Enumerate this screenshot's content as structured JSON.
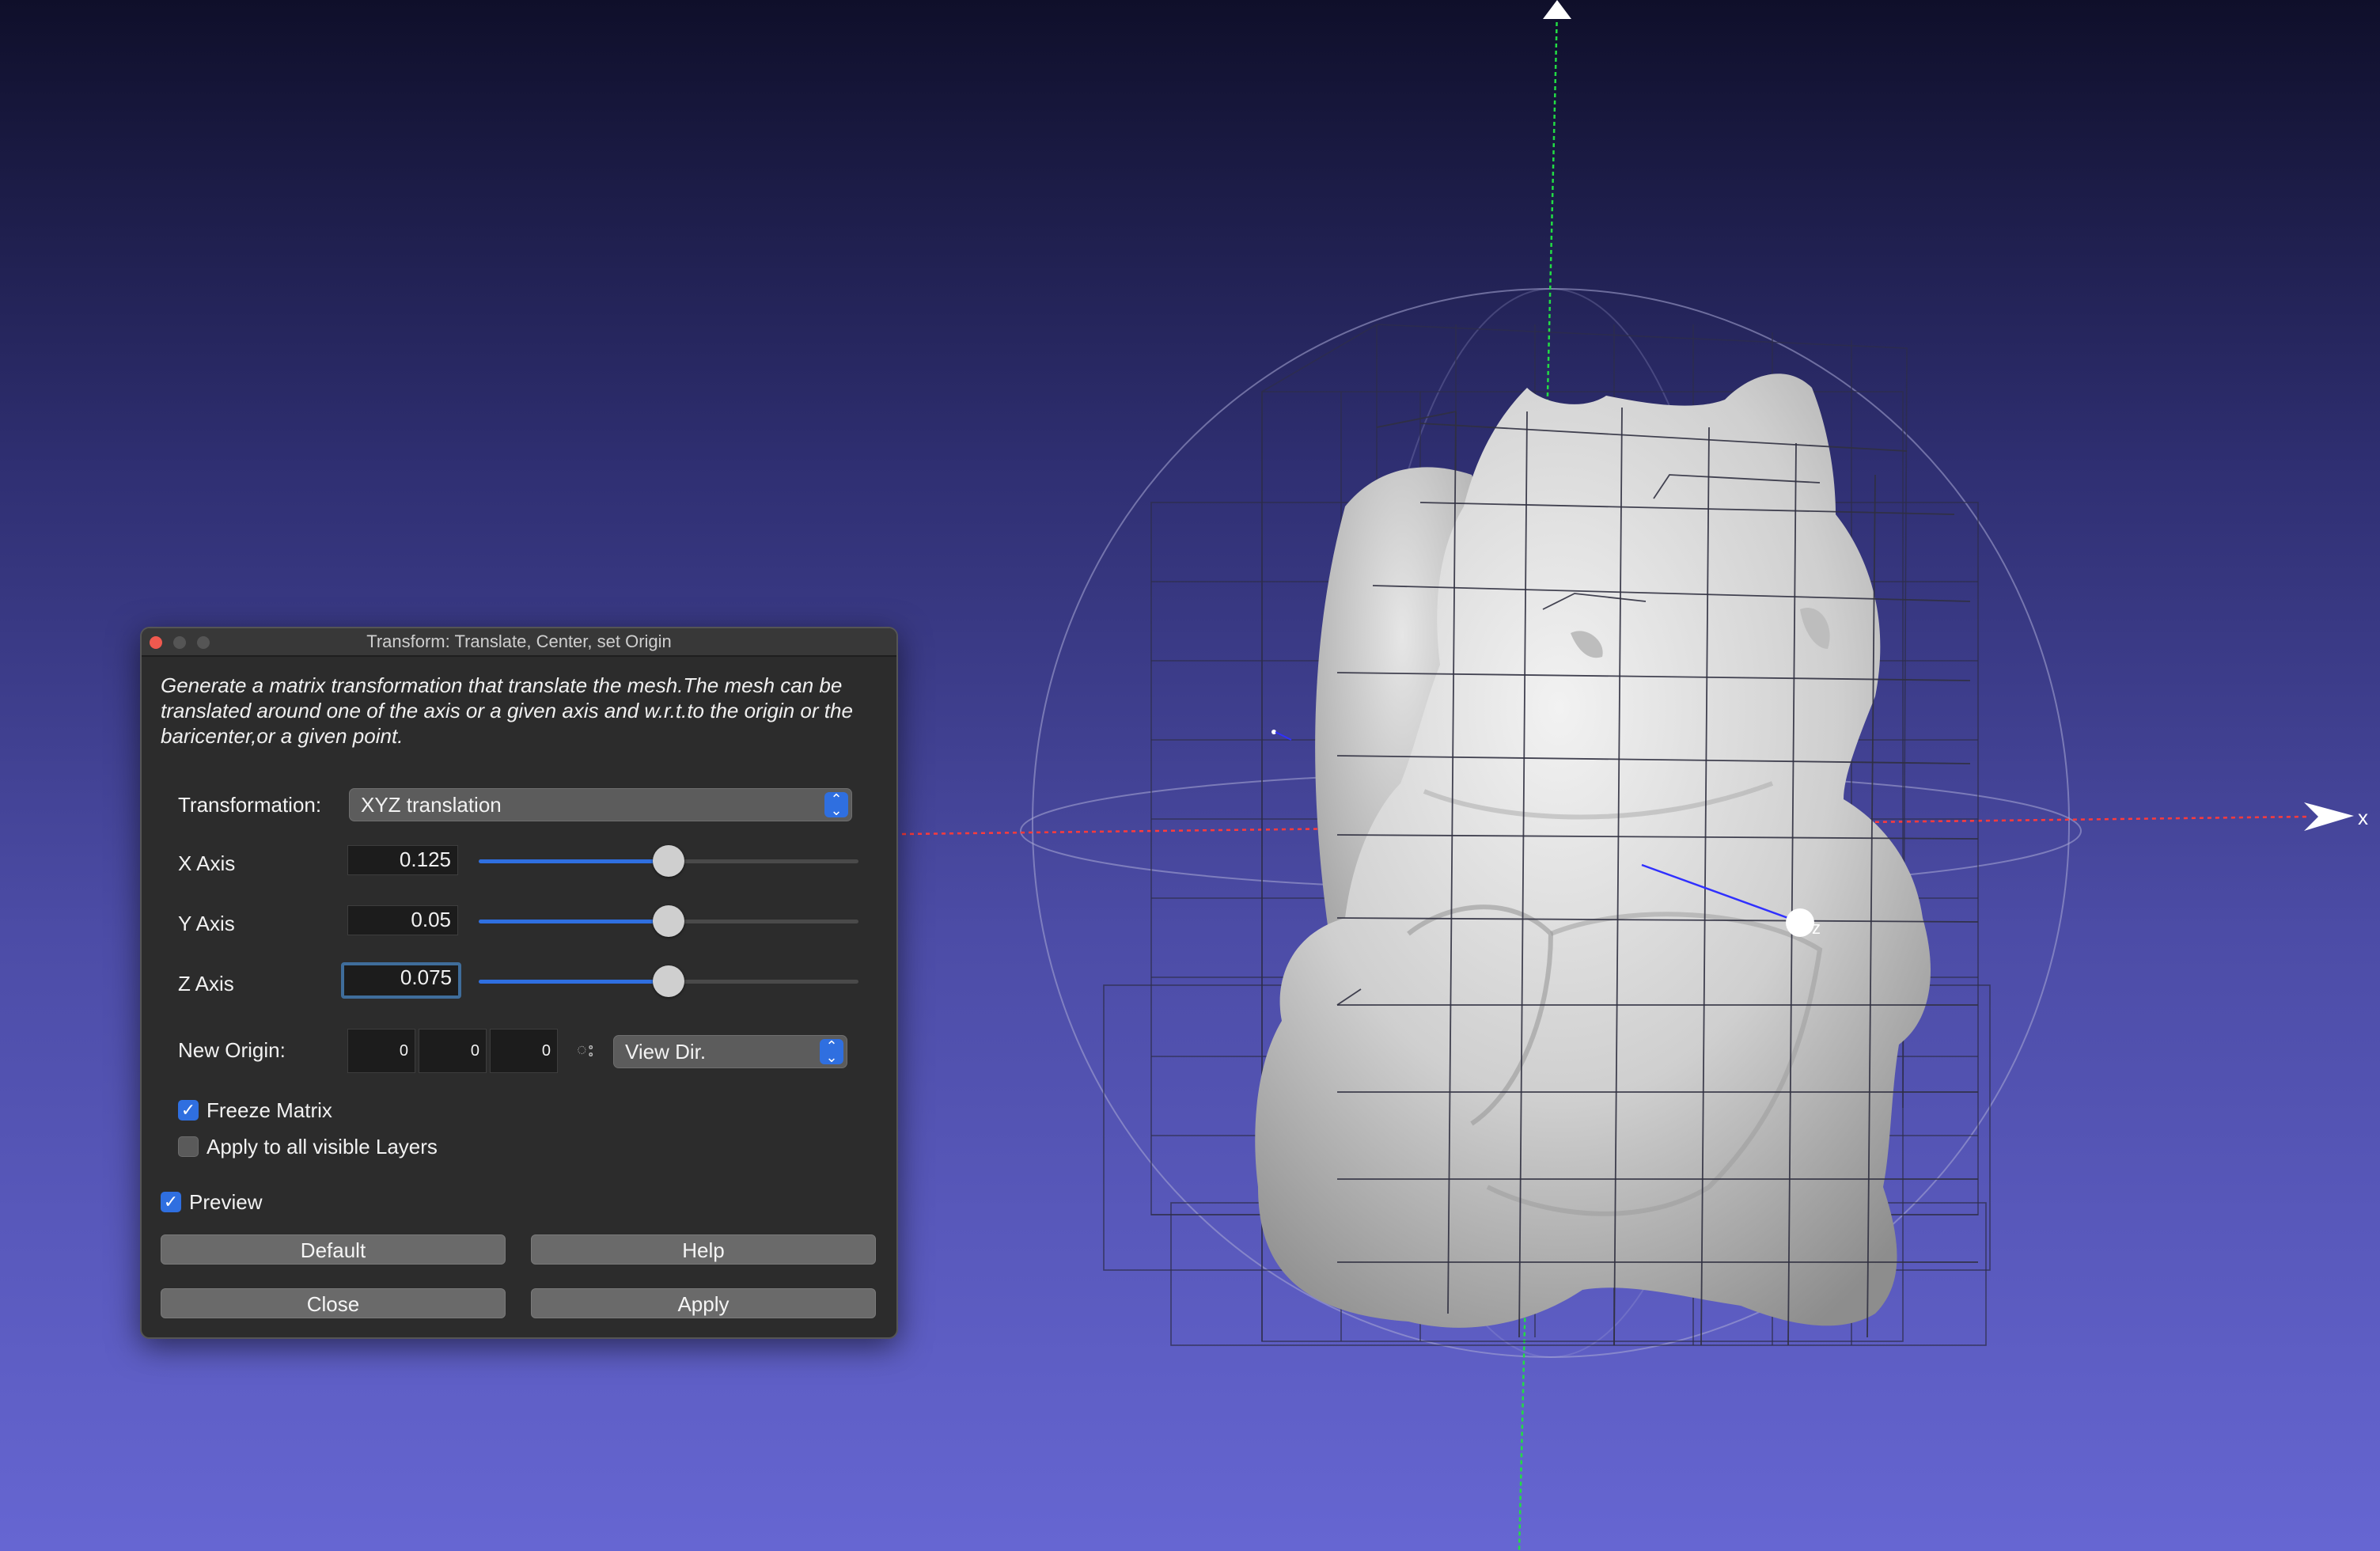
{
  "dialog": {
    "title": "Transform: Translate, Center, set Origin",
    "description": "Generate a matrix transformation that translate the mesh.The mesh can be translated around one of the axis or a given axis and w.r.t.to the origin or the baricenter,or a given point.",
    "transformation_label": "Transformation:",
    "transformation_value": "XYZ translation",
    "x_axis": {
      "label": "X Axis",
      "value": "0.125",
      "slider_fraction": 0.5
    },
    "y_axis": {
      "label": "Y Axis",
      "value": "0.05",
      "slider_fraction": 0.5
    },
    "z_axis": {
      "label": "Z Axis",
      "value": "0.075",
      "slider_fraction": 0.5
    },
    "new_origin": {
      "label": "New Origin:",
      "x": "0",
      "y": "0",
      "z": "0",
      "picker_glyph": "ះ",
      "mode": "View Dir."
    },
    "freeze_matrix": {
      "label": "Freeze Matrix",
      "checked": true
    },
    "apply_all_layers": {
      "label": "Apply to all visible Layers",
      "checked": false
    },
    "preview": {
      "label": "Preview",
      "checked": true
    },
    "buttons": {
      "default": "Default",
      "help": "Help",
      "close": "Close",
      "apply": "Apply"
    }
  },
  "viewport": {
    "axis_x_label": "x",
    "axis_z_label": "z",
    "axis_colors": {
      "x": "#ff3b3b",
      "y": "#22dd44",
      "z": "#2a2aff"
    },
    "mesh_color": "#d6d6d6"
  }
}
